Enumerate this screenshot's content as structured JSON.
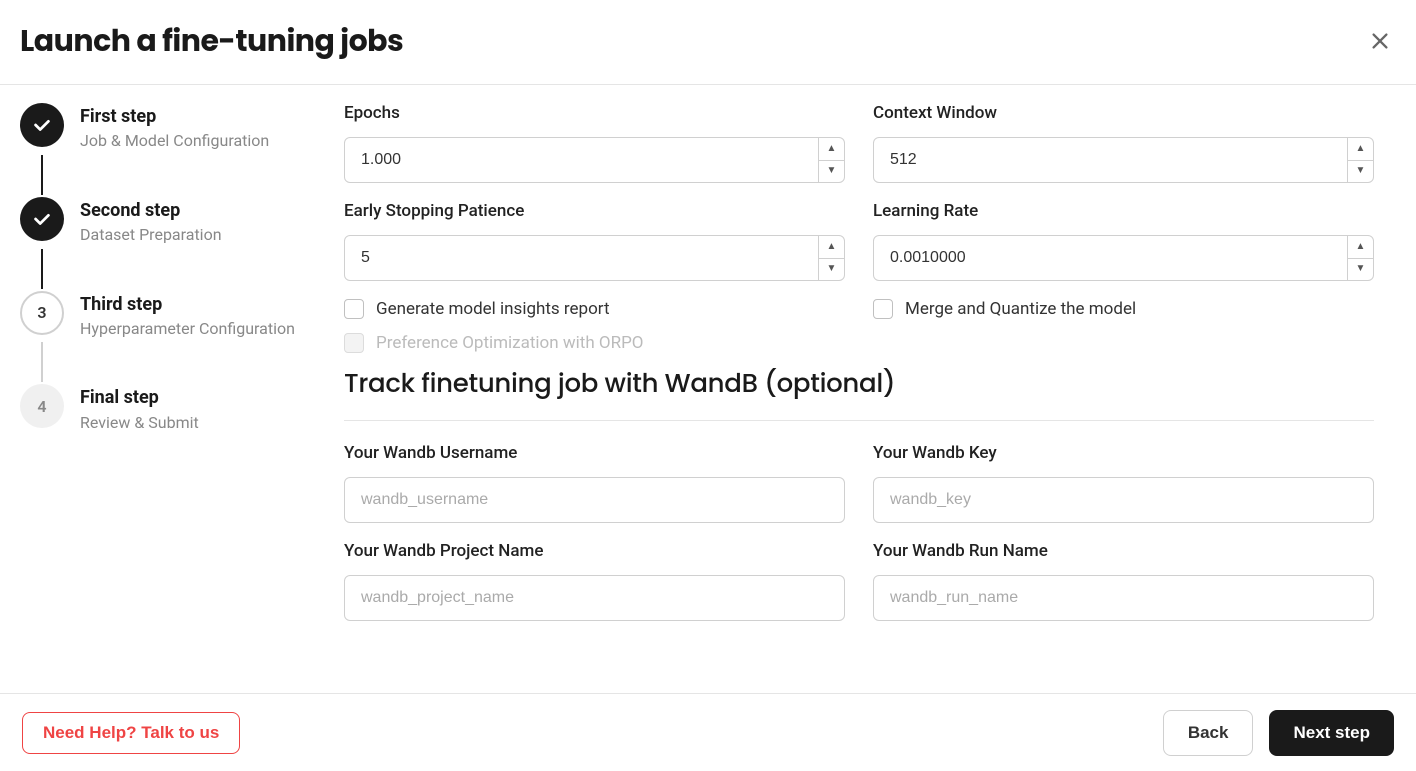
{
  "header": {
    "title": "Launch a fine-tuning jobs"
  },
  "stepper": {
    "steps": [
      {
        "title": "First step",
        "sub": "Job & Model Configuration",
        "state": "done"
      },
      {
        "title": "Second step",
        "sub": "Dataset Preparation",
        "state": "done"
      },
      {
        "title": "Third step",
        "sub": "Hyperparameter Configuration",
        "state": "active",
        "num": "3"
      },
      {
        "title": "Final step",
        "sub": "Review & Submit",
        "state": "pending",
        "num": "4"
      }
    ]
  },
  "form": {
    "epochs": {
      "label": "Epochs",
      "value": "1.000"
    },
    "context_window": {
      "label": "Context Window",
      "value": "512"
    },
    "early_stop": {
      "label": "Early Stopping Patience",
      "value": "5"
    },
    "learning_rate": {
      "label": "Learning Rate",
      "value": "0.0010000"
    },
    "check_insights": "Generate model insights report",
    "check_merge": "Merge and Quantize the model",
    "check_orpo": "Preference Optimization with ORPO",
    "section_title": "Track finetuning job with WandB (optional)",
    "wandb_user": {
      "label": "Your Wandb Username",
      "placeholder": "wandb_username"
    },
    "wandb_key": {
      "label": "Your Wandb Key",
      "placeholder": "wandb_key"
    },
    "wandb_project": {
      "label": "Your Wandb Project Name",
      "placeholder": "wandb_project_name"
    },
    "wandb_run": {
      "label": "Your Wandb Run Name",
      "placeholder": "wandb_run_name"
    }
  },
  "footer": {
    "help": "Need Help? Talk to us",
    "back": "Back",
    "next": "Next step"
  }
}
